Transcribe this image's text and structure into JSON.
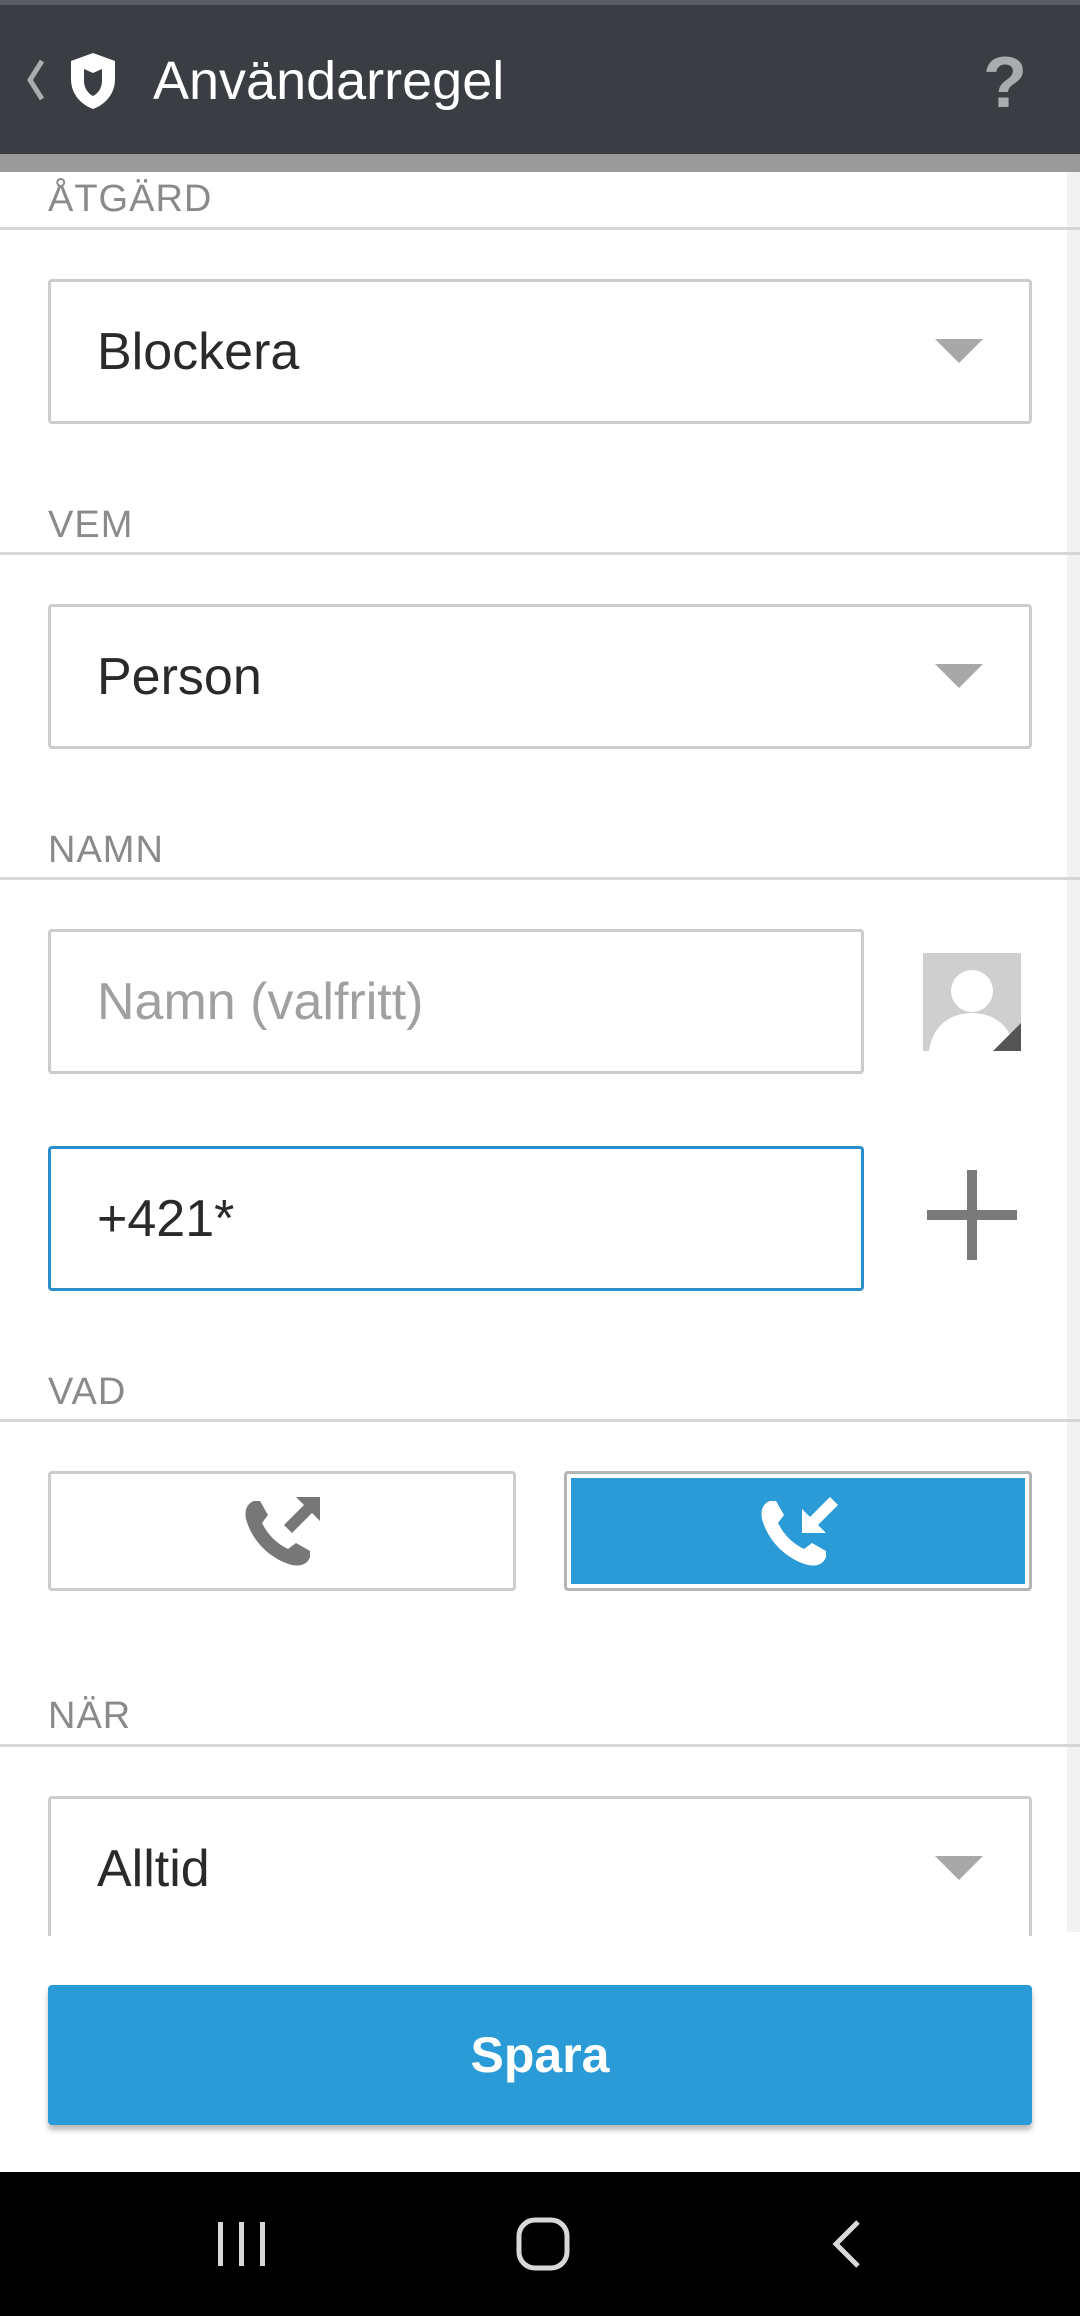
{
  "header": {
    "title": "Användarregel",
    "help_label": "?",
    "icons": {
      "back": "chevron-left-icon",
      "logo": "shield-icon"
    },
    "background_color": "#3a3d42"
  },
  "sections": {
    "action": {
      "label": "ÅTGÄRD",
      "selected": "Blockera"
    },
    "who": {
      "label": "VEM",
      "selected": "Person"
    },
    "name": {
      "label": "NAMN",
      "name_placeholder": "Namn (valfritt)",
      "number_value": "+421*",
      "icons": {
        "contact": "contact-picker-icon",
        "add": "plus-icon"
      }
    },
    "what": {
      "label": "VAD",
      "options": [
        {
          "icon": "outgoing-call-icon",
          "selected": false
        },
        {
          "icon": "incoming-call-icon",
          "selected": true
        }
      ]
    },
    "when": {
      "label": "NÄR",
      "selected": "Alltid"
    }
  },
  "save_button": {
    "label": "Spara"
  },
  "colors": {
    "accent": "#2a9bd6",
    "focus_border": "#2a8ec8"
  },
  "system_nav": {
    "icons": [
      "recent-apps-icon",
      "home-icon",
      "back-icon"
    ]
  }
}
